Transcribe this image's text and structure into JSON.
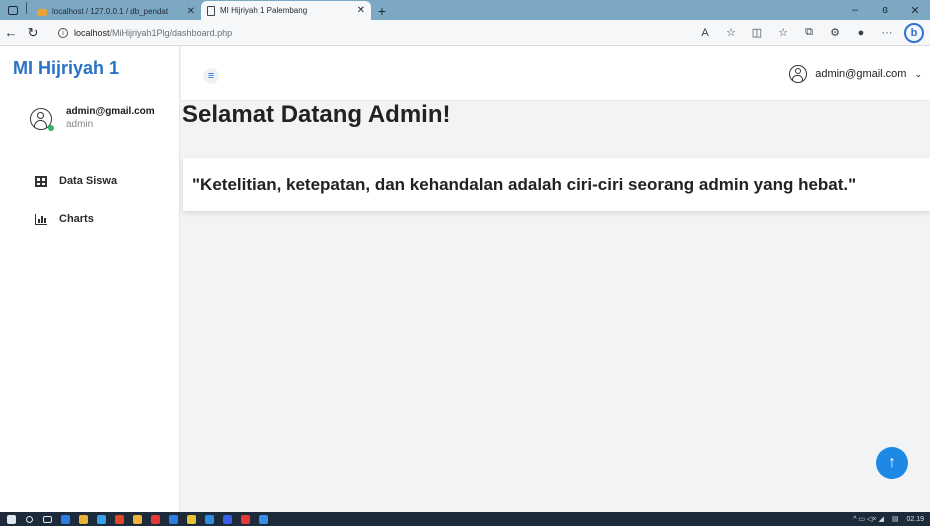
{
  "browser": {
    "tabs": [
      {
        "label": "localhost / 127.0.0.1 / db_pendat",
        "active": false
      },
      {
        "label": "MI Hijriyah 1 Palembang",
        "active": true
      }
    ],
    "window_controls": {
      "minimize": "–",
      "maximize": "ɞ",
      "close": "✕"
    },
    "url_host": "localhost",
    "url_path": "/MiHijriyah1Plg/dashboard.php",
    "toolbar_icons": [
      "read-aloud-icon",
      "favorite-star-icon",
      "split-screen-icon",
      "favorites-icon",
      "collections-icon",
      "extensions-icon",
      "profile-icon",
      "more-icon",
      "bing-icon"
    ]
  },
  "sidebar": {
    "brand": "MI Hijriyah 1",
    "profile": {
      "name": "admin@gmail.com",
      "role": "admin"
    },
    "items": [
      {
        "label": "Data Siswa",
        "icon": "table-icon"
      },
      {
        "label": "Charts",
        "icon": "chart-icon"
      }
    ]
  },
  "topbar": {
    "toggle_icon": "≡",
    "user_email": "admin@gmail.com",
    "caret": "⌄"
  },
  "main": {
    "title": "Selamat Datang Admin!",
    "quote": "\"Ketelitian, ketepatan, dan kehandalan adalah ciri-ciri seorang admin yang hebat.\""
  },
  "fab": {
    "icon": "↑"
  },
  "taskbar": {
    "time": "02.19",
    "tray_text": "^ ▭ ◁× ◢",
    "app_colors": [
      "#2f7de1",
      "#e8b23a",
      "#3aa0e8",
      "#e2472b",
      "#f0b43c",
      "#e23a3a",
      "#2f7de1",
      "#e8c23a",
      "#2f8de1",
      "#3a5fe8",
      "#e23a3a",
      "#3a8de8"
    ]
  },
  "colors": {
    "brand": "#2a72c5",
    "fab": "#1e88e5",
    "online": "#2bb673"
  }
}
